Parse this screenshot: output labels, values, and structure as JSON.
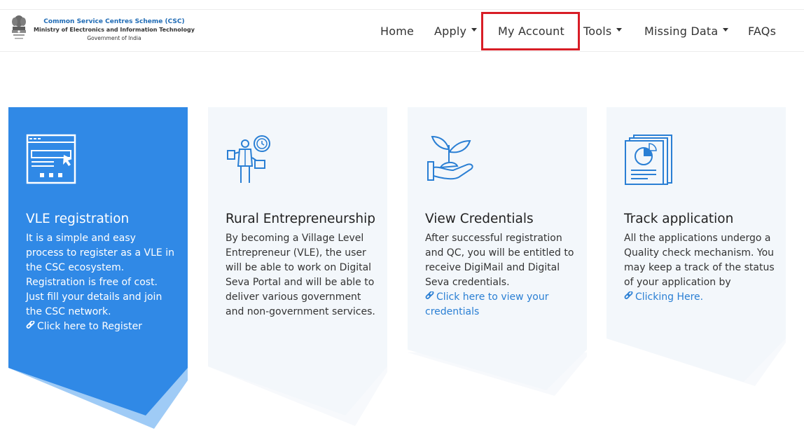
{
  "header": {
    "brand_title": "Common Service Centres Scheme (CSC)",
    "brand_ministry": "Ministry of Electronics and Information Technology",
    "brand_government": "Government of India",
    "emblem_icon": "national-emblem-icon"
  },
  "nav": {
    "items": [
      {
        "label": "Home",
        "has_caret": false
      },
      {
        "label": "Apply",
        "has_caret": true
      },
      {
        "label": "My Account",
        "has_caret": false,
        "highlighted": true
      },
      {
        "label": "Tools",
        "has_caret": true
      },
      {
        "label": "Missing Data",
        "has_caret": true
      },
      {
        "label": "FAQs",
        "has_caret": false
      }
    ],
    "highlight_color": "#d81d26"
  },
  "cards": [
    {
      "title": "VLE registration",
      "description": "It is a simple and easy process to register as a VLE in the CSC ecosystem. Registration is free of cost. Just fill your details and join the CSC network.",
      "link": "Click here to Register",
      "icon": "browser-window-icon",
      "style": "blue"
    },
    {
      "title": "Rural Entrepreneurship",
      "description": "By becoming a Village Level Entrepreneur (VLE), the user will be able to work on Digital Seva Portal and will be able to deliver various government and non-government services.",
      "link": "",
      "icon": "businessman-icon",
      "style": "light"
    },
    {
      "title": "View Credentials",
      "description": "After successful registration and QC, you will be entitled to receive DigiMail and Digital Seva credentials.",
      "link": "Click here to view your credentials",
      "icon": "plant-in-hand-icon",
      "style": "light"
    },
    {
      "title": "Track application",
      "description": "All the applications undergo a Quality check mechanism. You may keep a track of the status of your application by",
      "link": "Clicking Here.",
      "icon": "report-chart-icon",
      "style": "light"
    }
  ],
  "colors": {
    "primary_blue": "#3089e6",
    "light_card": "#f3f7fb",
    "link_blue": "#2a7fd4",
    "brand_blue": "#1f6bb5"
  }
}
